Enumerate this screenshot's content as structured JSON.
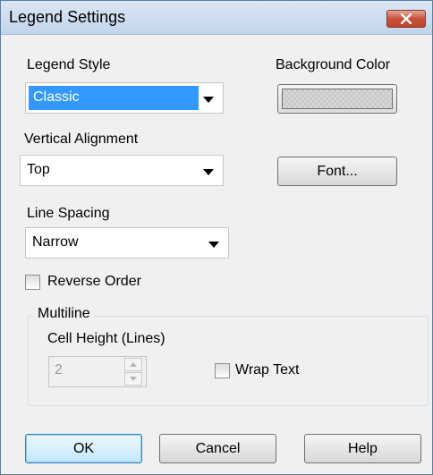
{
  "window": {
    "title": "Legend Settings"
  },
  "legend_style": {
    "label": "Legend Style",
    "selected": "Classic"
  },
  "background_color": {
    "label": "Background Color"
  },
  "vertical_alignment": {
    "label": "Vertical Alignment",
    "selected": "Top"
  },
  "font_button": {
    "label": "Font..."
  },
  "line_spacing": {
    "label": "Line Spacing",
    "selected": "Narrow"
  },
  "reverse_order": {
    "label": "Reverse Order",
    "checked": false
  },
  "multiline": {
    "caption": "Multiline",
    "cell_height_label": "Cell Height (Lines)",
    "cell_height_value": "2",
    "wrap_text_label": "Wrap Text",
    "wrap_text_checked": false
  },
  "buttons": {
    "ok": "OK",
    "cancel": "Cancel",
    "help": "Help"
  },
  "colors": {
    "selection": "#3399ff",
    "titlebar": "#c3d5ea",
    "close_button": "#c8513b",
    "dialog_background": "#f0f0f0"
  }
}
